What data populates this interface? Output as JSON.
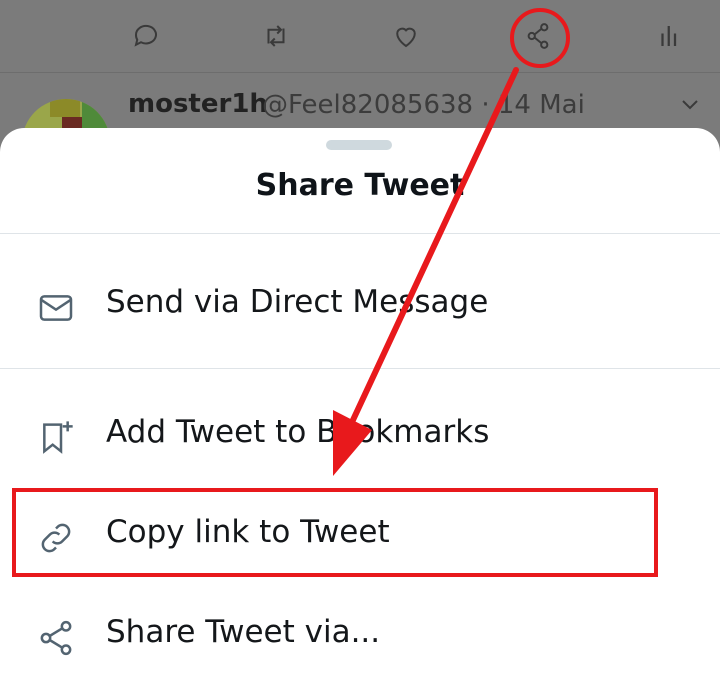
{
  "reply": {
    "name": "moster1h",
    "handle_date": "@Feel82085638 · 14 Mai"
  },
  "action_bar": {
    "icons": [
      "reply-icon",
      "retweet-icon",
      "like-icon",
      "share-icon",
      "analytics-icon"
    ]
  },
  "sheet": {
    "title": "Share Tweet",
    "items": [
      {
        "label": "Send via Direct Message",
        "icon": "envelope-icon"
      },
      {
        "label": "Add Tweet to Bookmarks",
        "icon": "bookmark-add-icon"
      },
      {
        "label": "Copy link to Tweet",
        "icon": "link-icon"
      },
      {
        "label": "Share Tweet via...",
        "icon": "share-icon"
      }
    ]
  },
  "colors": {
    "annotation_red": "#e8191c",
    "icon_gray": "#536471",
    "backdrop": "#7b7b7b"
  }
}
